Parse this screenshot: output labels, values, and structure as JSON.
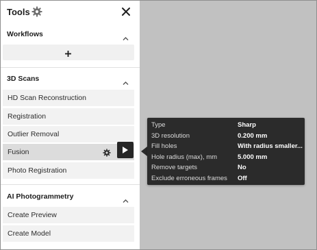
{
  "panel": {
    "title": "Tools",
    "icons": {
      "settings": "gear-icon",
      "close": "close-icon"
    }
  },
  "workflows": {
    "title": "Workflows",
    "add_icon": "plus-icon",
    "chevron": "chevron-up-icon"
  },
  "scans": {
    "title": "3D Scans",
    "chevron": "chevron-up-icon",
    "items": [
      {
        "label": "HD Scan Reconstruction"
      },
      {
        "label": "Registration"
      },
      {
        "label": "Outlier Removal"
      },
      {
        "label": "Fusion",
        "active": true
      },
      {
        "label": "Photo Registration"
      }
    ]
  },
  "photogrammetry": {
    "title": "AI Photogrammetry",
    "chevron": "chevron-up-icon",
    "items": [
      {
        "label": "Create Preview"
      },
      {
        "label": "Create Model"
      }
    ]
  },
  "tooltip": {
    "rows": [
      {
        "key": "Type",
        "value": "Sharp"
      },
      {
        "key": "3D resolution",
        "value": "0.200 mm"
      },
      {
        "key": "Fill holes",
        "value": "With radius smaller..."
      },
      {
        "key": "Hole radius (max), mm",
        "value": "5.000 mm"
      },
      {
        "key": "Remove targets",
        "value": "No"
      },
      {
        "key": "Exclude erroneous frames",
        "value": "Off"
      }
    ]
  },
  "colors": {
    "canvas": "#c1c1c1",
    "panel": "#ffffff",
    "item_bg": "#f2f2f2",
    "item_active": "#dcdcdc",
    "run_button": "#262626",
    "tooltip_bg": "#2b2b2b"
  }
}
